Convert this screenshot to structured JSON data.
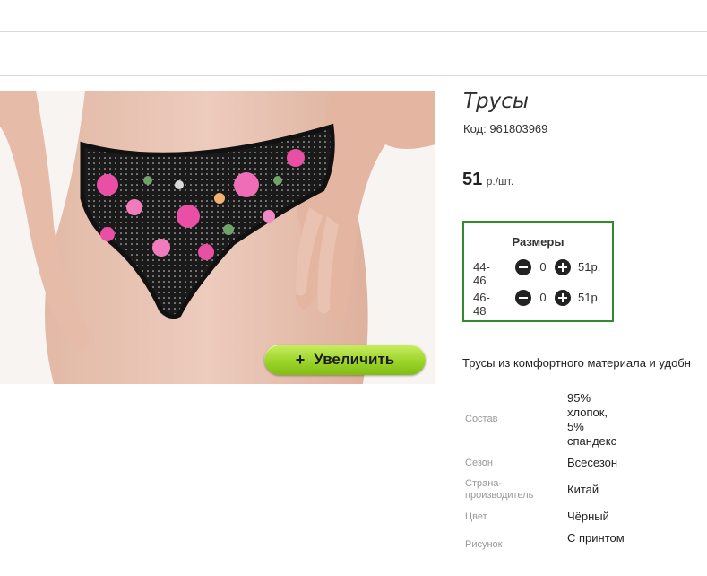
{
  "header": {},
  "product": {
    "title": "Трусы",
    "code": "Код: 961803969",
    "price_value": "51",
    "price_unit": "р./шт.",
    "zoom_button": {
      "symbol": "+",
      "label": "Увеличить"
    },
    "sizes_title": "Размеры",
    "sizes": [
      {
        "name": "44-46",
        "qty": "0",
        "price": "51р."
      },
      {
        "name": "46-48",
        "qty": "0",
        "price": "51р."
      }
    ],
    "description": "Трусы из комфортного материала и удобн",
    "specs": [
      {
        "label": "Состав",
        "value": "95% хлопок, 5% спандекс"
      },
      {
        "label": "Сезон",
        "value": "Всесезон"
      },
      {
        "label": "Страна-производитель",
        "value": "Китай"
      },
      {
        "label": "Цвет",
        "value": "Чёрный"
      },
      {
        "label": "Рисунок",
        "value": "С принтом"
      }
    ]
  },
  "icons": {
    "minus": "minus-circle-icon",
    "plus": "plus-circle-icon"
  },
  "colors": {
    "sizes_border": "#2e8b2e",
    "zoom_button": "#9cd42a"
  }
}
